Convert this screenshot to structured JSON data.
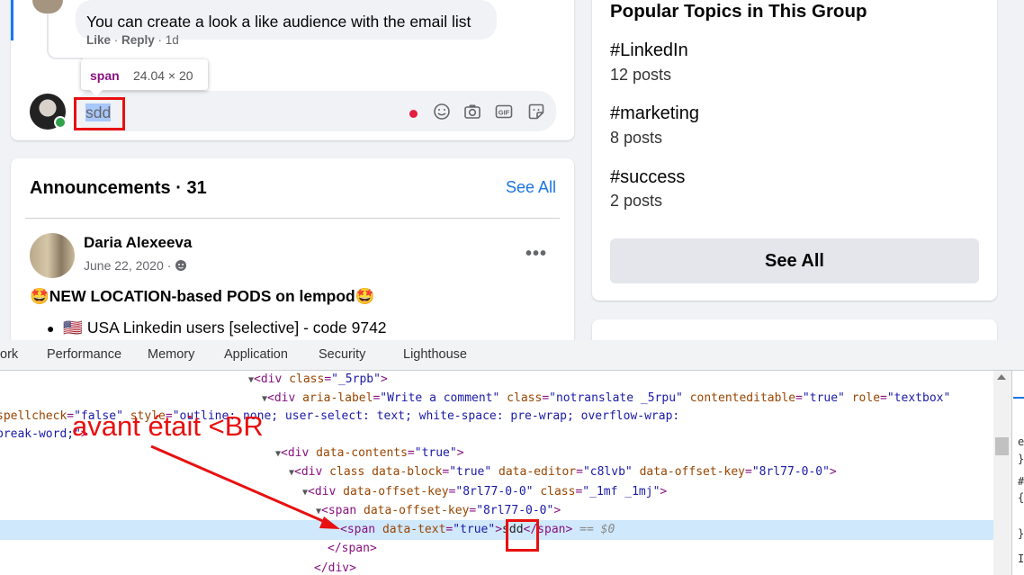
{
  "reply": {
    "text": "You can create a look a like audience with the email list",
    "like": "Like",
    "reply": "Reply",
    "age": "1d"
  },
  "inspector_tooltip": {
    "tag": "span",
    "dims": "24.04 × 20"
  },
  "comment_input": {
    "value": "sdd"
  },
  "announcements": {
    "title": "Announcements · 31",
    "see_all": "See All",
    "post": {
      "author": "Daria Alexeeva",
      "date": "June 22, 2020 · ",
      "title": "🤩NEW LOCATION-based PODS on lempod🤩",
      "bullet": "🇺🇸 USA Linkedin users [selective] - code 9742"
    }
  },
  "topics": {
    "title": "Popular Topics in This Group",
    "items": [
      {
        "name": "#LinkedIn",
        "count": "12 posts"
      },
      {
        "name": "#marketing",
        "count": "8 posts"
      },
      {
        "name": "#success",
        "count": "2 posts"
      }
    ],
    "see_all": "See All"
  },
  "devtools": {
    "tabs": [
      "ork",
      "Performance",
      "Memory",
      "Application",
      "Security",
      "Lighthouse"
    ],
    "selected_marker": "== $0",
    "annotation": "avant était <BR"
  }
}
